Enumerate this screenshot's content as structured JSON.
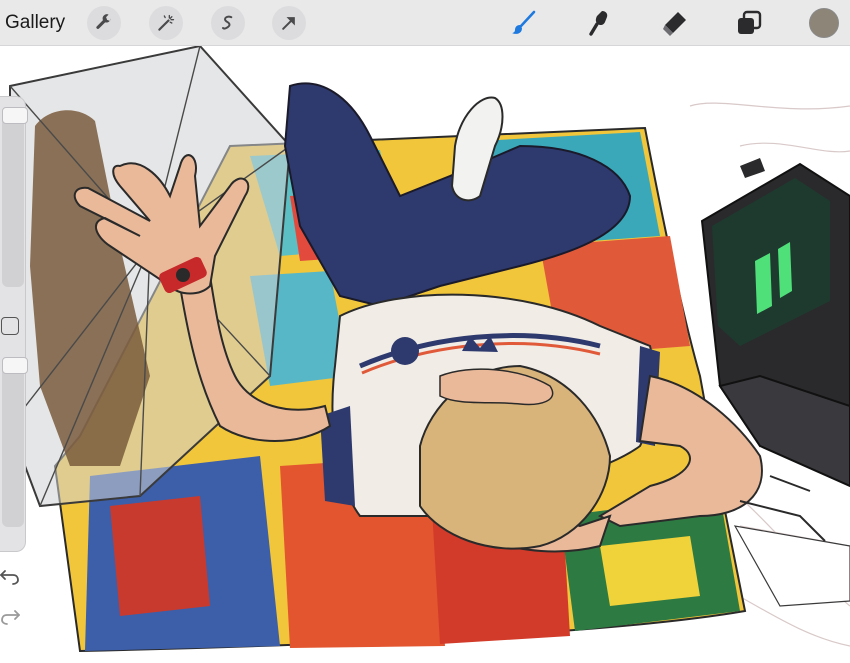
{
  "toolbar": {
    "gallery_label": "Gallery",
    "left_tools": [
      "wrench-icon",
      "magic-wand-icon",
      "selection-icon",
      "transform-arrow-icon"
    ],
    "right_tools": [
      "brush-icon",
      "smudge-icon",
      "eraser-icon",
      "layers-icon"
    ],
    "active_tool": "brush-icon",
    "active_color": "#8c8578",
    "accent_color": "#1f7ae0"
  },
  "sidebar": {
    "brush_size_level": 0.0,
    "opacity_level": 0.0,
    "icons": [
      "modify-square-icon",
      "undo-icon",
      "redo-icon"
    ]
  }
}
